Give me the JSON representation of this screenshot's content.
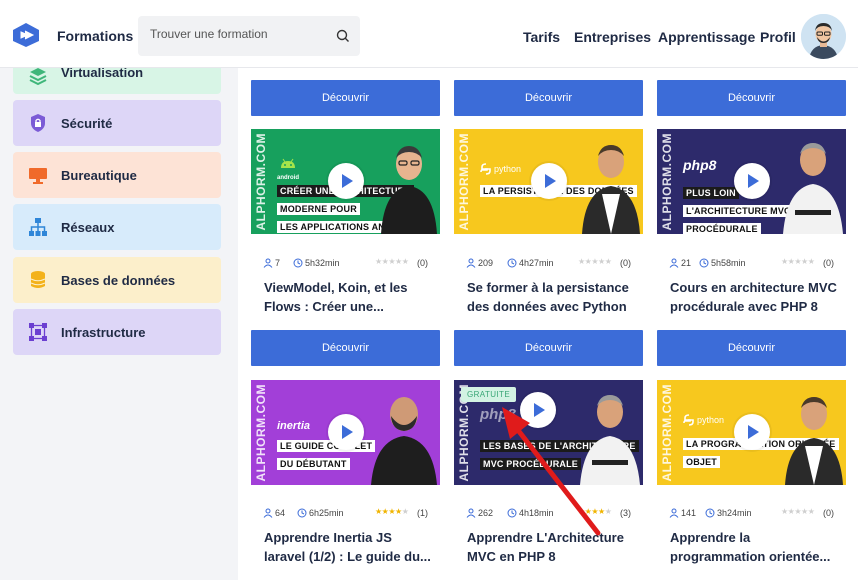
{
  "header": {
    "brand": "Formations",
    "search_placeholder": "Trouver une formation",
    "nav": [
      "Tarifs",
      "Entreprises",
      "Apprentissage",
      "Profil"
    ]
  },
  "sidebar": {
    "items": [
      {
        "label": "Virtualisation",
        "icon": "layers-icon",
        "bg": "#d8f5e6",
        "color": "#3fb67a"
      },
      {
        "label": "Sécurité",
        "icon": "shield-lock-icon",
        "bg": "#ddd6f7",
        "color": "#7b5bd6"
      },
      {
        "label": "Bureautique",
        "icon": "monitor-icon",
        "bg": "#fde3d6",
        "color": "#f06a2a"
      },
      {
        "label": "Réseaux",
        "icon": "network-icon",
        "bg": "#d7ebfb",
        "color": "#2f86d8"
      },
      {
        "label": "Bases de données",
        "icon": "database-icon",
        "bg": "#fcefcb",
        "color": "#f3b21a"
      },
      {
        "label": "Infrastructure",
        "icon": "infrastructure-icon",
        "bg": "#ddd6f7",
        "color": "#6b3fd1"
      }
    ]
  },
  "cards": {
    "discover_label": "Découvrir",
    "brand_watermark": "ALPHORM.COM",
    "row1": [
      {
        "tech": "android",
        "title_lines": [
          "CRÉER UNE ARCHITECTURE",
          "MODERNE POUR",
          "LES APPLICATIONS ANDROID"
        ],
        "learners": "7",
        "duration": "5h32min",
        "rating": 0,
        "reviews": "(0)",
        "title": "ViewModel, Koin, et les Flows : Créer une...",
        "theme": "#17a05d"
      },
      {
        "tech": "python",
        "title_lines": [
          "LA PERSISTANCE DES DONNÉES"
        ],
        "learners": "209",
        "duration": "4h27min",
        "rating": 0,
        "reviews": "(0)",
        "title": "Se former à la persistance des données avec Python",
        "theme": "#f7c81e"
      },
      {
        "tech": "php8",
        "title_lines": [
          "PLUS LOIN",
          "L'ARCHITECTURE MVC",
          "PROCÉDURALE"
        ],
        "learners": "21",
        "duration": "5h58min",
        "rating": 0,
        "reviews": "(0)",
        "title": "Cours en architecture MVC procédurale avec PHP 8",
        "theme": "#2d2a6b"
      }
    ],
    "row2": [
      {
        "tech": "inertia",
        "title_lines": [
          "LE GUIDE COMPLET",
          "DU DÉBUTANT"
        ],
        "learners": "64",
        "duration": "6h25min",
        "rating": 4,
        "reviews": "(1)",
        "title": "Apprendre Inertia JS laravel (1/2) : Le guide du...",
        "theme": "#a23fd8"
      },
      {
        "tech": "php8",
        "badge": "GRATUITE",
        "title_lines": [
          "LES BASES DE L'ARCHITECTURE",
          "MVC PROCÉDURALE"
        ],
        "learners": "262",
        "duration": "4h18min",
        "rating": 4,
        "reviews": "(3)",
        "title": "Apprendre L'Architecture MVC en PHP 8",
        "theme": "#2d2a6b"
      },
      {
        "tech": "python",
        "title_lines": [
          "LA PROGRAMMATION ORIENTÉE",
          "OBJET"
        ],
        "learners": "141",
        "duration": "3h24min",
        "rating": 0,
        "reviews": "(0)",
        "title": "Apprendre la programmation orientée...",
        "theme": "#f7c81e"
      }
    ]
  },
  "colors": {
    "primary": "#3c6cd8",
    "annotation_arrow": "#e01b1b",
    "star_filled": "#f0b400"
  }
}
